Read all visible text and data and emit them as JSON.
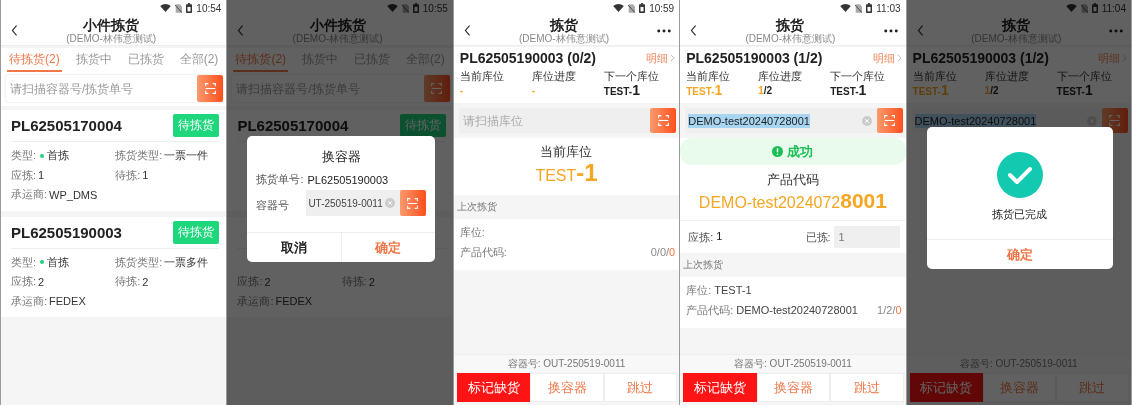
{
  "screens": [
    {
      "kind": "list",
      "time": "10:54",
      "header": {
        "title": "小件拣货",
        "subtitle": "(DEMO-林伟意测试)"
      },
      "tabs": [
        {
          "label": "待拣货(2)",
          "selected": true
        },
        {
          "label": "拣货中",
          "selected": false
        },
        {
          "label": "已拣货",
          "selected": false
        },
        {
          "label": "全部(2)",
          "selected": false
        }
      ],
      "search": {
        "placeholder": "请扫描容器号/拣货单号"
      },
      "orders": [
        {
          "number": "PL62505170004",
          "status": "待拣货",
          "rows": [
            {
              "kind": "fields",
              "cells": [
                {
                  "kind": "dot",
                  "label": "类型:",
                  "value": "首拣"
                },
                {
                  "kind": "plain",
                  "label": "拣货类型:",
                  "value": "一票一件"
                }
              ]
            },
            {
              "kind": "fields",
              "cells": [
                {
                  "kind": "plain",
                  "label": "应拣:",
                  "value": "1"
                },
                {
                  "kind": "plain",
                  "label": "待拣:",
                  "value": "1"
                }
              ]
            },
            {
              "kind": "fields",
              "cells": [
                {
                  "kind": "plain",
                  "label": "承运商:",
                  "value": "WP_DMS"
                }
              ]
            }
          ]
        },
        {
          "number": "PL62505190003",
          "status": "待拣货",
          "rows": [
            {
              "kind": "fields",
              "cells": [
                {
                  "kind": "dot",
                  "label": "类型:",
                  "value": "首拣"
                },
                {
                  "kind": "plain",
                  "label": "拣货类型:",
                  "value": "一票多件"
                }
              ]
            },
            {
              "kind": "fields",
              "cells": [
                {
                  "kind": "plain",
                  "label": "应拣:",
                  "value": "2"
                },
                {
                  "kind": "plain",
                  "label": "待拣:",
                  "value": "2"
                }
              ]
            },
            {
              "kind": "fields",
              "cells": [
                {
                  "kind": "plain",
                  "label": "承运商:",
                  "value": "FEDEX"
                }
              ]
            }
          ]
        }
      ]
    },
    {
      "kind": "list",
      "time": "10:55",
      "header": {
        "title": "小件拣货",
        "subtitle": "(DEMO-林伟意测试)"
      },
      "tabs": [
        {
          "label": "待拣货(2)",
          "selected": true
        },
        {
          "label": "拣货中",
          "selected": false
        },
        {
          "label": "已拣货",
          "selected": false
        },
        {
          "label": "全部(2)",
          "selected": false
        }
      ],
      "search": {
        "placeholder": "请扫描容器号/拣货单号"
      },
      "orders": [
        {
          "number": "PL62505170004",
          "status": "待拣货",
          "rows": [
            {
              "kind": "covered"
            },
            {
              "kind": "covered"
            },
            {
              "kind": "covered"
            }
          ]
        },
        {
          "rows": [
            {
              "kind": "covered"
            },
            {
              "kind": "fields",
              "cells": [
                {
                  "kind": "plain",
                  "label": "应拣:",
                  "value": "2"
                },
                {
                  "kind": "plain",
                  "label": "待拣:",
                  "value": "2"
                }
              ]
            },
            {
              "kind": "fields",
              "cells": [
                {
                  "kind": "plain",
                  "label": "承运商:",
                  "value": "FEDEX"
                }
              ]
            }
          ]
        }
      ],
      "dialog": {
        "kind": "form",
        "title": "换容器",
        "rows": [
          {
            "label": "拣货单号:",
            "value": "PL62505190003"
          }
        ],
        "field": {
          "label": "容器号",
          "value": "UT-250519-0011"
        },
        "buttons": [
          {
            "label": "取消",
            "kind": "cancel"
          },
          {
            "label": "确定",
            "kind": "confirm"
          }
        ]
      }
    },
    {
      "kind": "pick",
      "time": "10:59",
      "header": {
        "title": "拣货",
        "subtitle": "(DEMO-林伟意测试)"
      },
      "order": {
        "title": "PL62505190003 (0/2)",
        "detail": "明细"
      },
      "info": [
        {
          "label": "当前库位",
          "accent": "-"
        },
        {
          "label": "库位进度",
          "accent": "-"
        },
        {
          "label": "下一个库位",
          "value": "TEST-**1**"
        }
      ],
      "scan": {
        "placeholder": "请扫描库位"
      },
      "sections": [
        {
          "kind": "location",
          "label": "当前库位",
          "value": "TEST**-1**"
        },
        {
          "kind": "last",
          "title": "上次拣货",
          "rows": [
            {
              "label": "库位:"
            },
            {
              "label": "产品代码:",
              "count": "0/0/",
              "count_accent": "0"
            }
          ]
        }
      ],
      "footer": {
        "container": "容器号: OUT-250519-0011",
        "actions": [
          {
            "label": "标记缺货",
            "kind": "danger"
          },
          {
            "label": "换容器",
            "kind": "plain"
          },
          {
            "label": "跳过",
            "kind": "plain"
          }
        ]
      }
    },
    {
      "kind": "pick",
      "time": "11:03",
      "header": {
        "title": "拣货",
        "subtitle": "(DEMO-林伟意测试)"
      },
      "order": {
        "title": "PL62505190003 (1/2)",
        "detail": "明细"
      },
      "info": [
        {
          "label": "当前库位",
          "accent": "TEST-**1**"
        },
        {
          "label": "库位进度",
          "accent": "1",
          "value": "/2"
        },
        {
          "label": "下一个库位",
          "value": "TEST-**1**"
        }
      ],
      "scan": {
        "value": "DEMO-test20240728001",
        "selected": true
      },
      "sections": [
        {
          "kind": "banner",
          "text": "成功"
        },
        {
          "kind": "product",
          "label": "产品代码",
          "value": "DEMO-test2024072**8001**"
        },
        {
          "kind": "quantity",
          "required_label": "应拣:",
          "required": "1",
          "picked_label": "已拣:",
          "picked": "1"
        },
        {
          "kind": "last",
          "title": "上次拣货",
          "rows": [
            {
              "label": "库位:",
              "value": "TEST-1"
            },
            {
              "label": "产品代码:",
              "value": "DEMO-test20240728001",
              "count": "1/2/",
              "count_accent": "0"
            }
          ]
        }
      ],
      "footer": {
        "container": "容器号: OUT-250519-0011",
        "actions": [
          {
            "label": "标记缺货",
            "kind": "danger"
          },
          {
            "label": "换容器",
            "kind": "plain"
          },
          {
            "label": "跳过",
            "kind": "plain"
          }
        ]
      }
    },
    {
      "kind": "pick",
      "time": "11:04",
      "header": {
        "title": "拣货",
        "subtitle": "(DEMO-林伟意测试)"
      },
      "order": {
        "title": "PL62505190003 (1/2)",
        "detail": "明细"
      },
      "info": [
        {
          "label": "当前库位",
          "accent": "TEST-**1**"
        },
        {
          "label": "库位进度",
          "accent": "1",
          "value": "/2"
        },
        {
          "label": "下一个库位",
          "value": "TEST-**1**"
        }
      ],
      "scan": {
        "value": "DEMO-test20240728001",
        "selected": true
      },
      "footer": {
        "container": "容器号: OUT-250519-0011",
        "actions": [
          {
            "label": "标记缺货",
            "kind": "danger"
          },
          {
            "label": "换容器",
            "kind": "plain"
          },
          {
            "label": "跳过",
            "kind": "plain"
          }
        ]
      },
      "dialog": {
        "kind": "done",
        "message": "拣货已完成",
        "buttons": [
          {
            "label": "确定",
            "kind": "confirm"
          }
        ]
      }
    }
  ]
}
